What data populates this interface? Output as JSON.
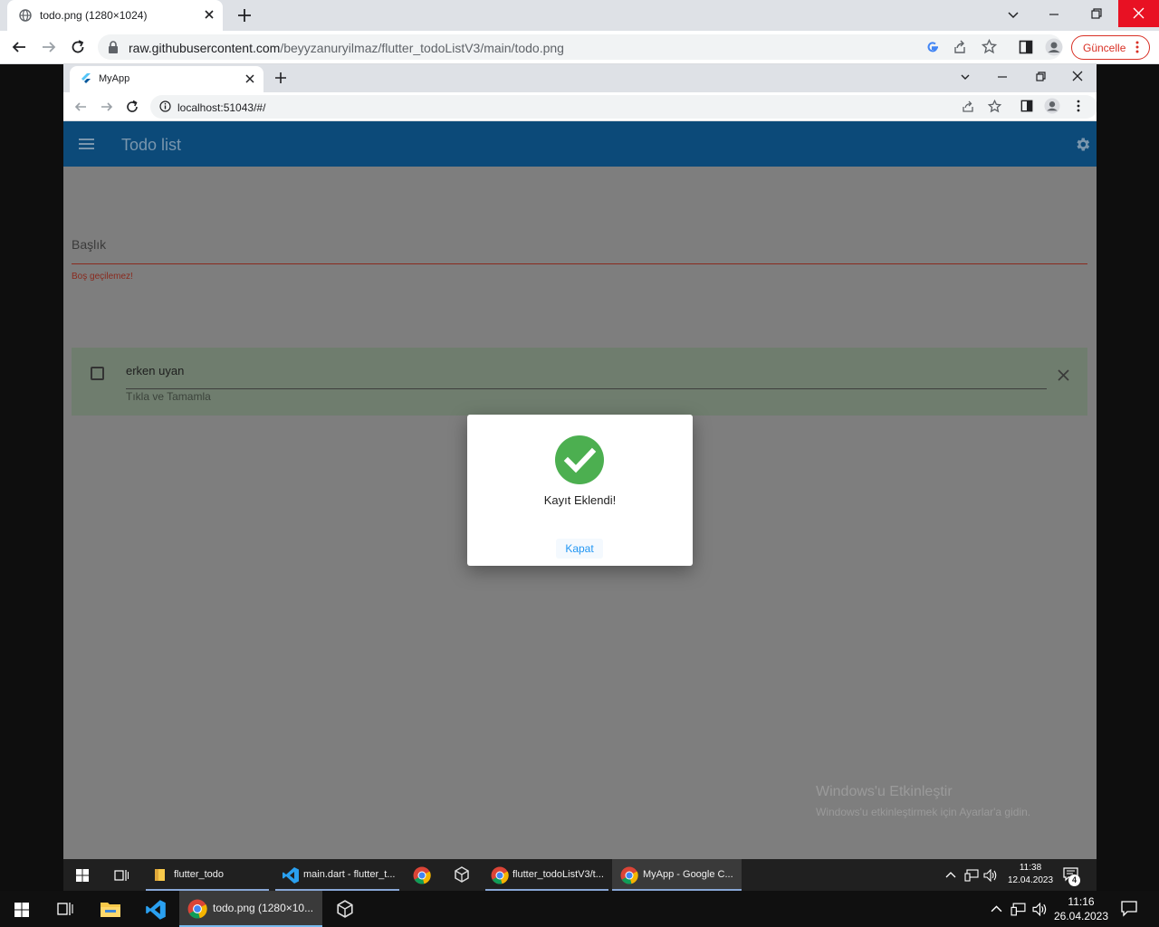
{
  "outer_browser": {
    "tab_title": "todo.png (1280×1024)",
    "url_host": "raw.githubusercontent.com",
    "url_path": "/beyyzanuryilmaz/flutter_todoListV3/main/todo.png",
    "update_label": "Güncelle"
  },
  "inner_browser": {
    "tab_title": "MyApp",
    "url": "localhost:51043/#/"
  },
  "app": {
    "title": "Todo list",
    "field_label": "Başlık",
    "field_error": "Boş geçilemez!",
    "todos": [
      {
        "title": "erken uyan",
        "subtitle": "Tıkla ve Tamamla",
        "checked": false
      }
    ]
  },
  "dialog": {
    "message": "Kayıt Eklendi!",
    "button": "Kapat"
  },
  "watermark": {
    "title": "Windows'u Etkinleştir",
    "subtitle": "Windows'u etkinleştirmek için Ayarlar'a gidin."
  },
  "inner_taskbar": {
    "items": [
      "flutter_todo",
      "main.dart - flutter_t...",
      "flutter_todoListV3/t...",
      "MyApp - Google C..."
    ],
    "time": "11:38",
    "date": "12.04.2023",
    "notifications": "4"
  },
  "outer_taskbar": {
    "items": [
      "todo.png (1280×10..."
    ],
    "time": "11:16",
    "date": "26.04.2023"
  },
  "colors": {
    "appbar": "#0c4a79",
    "success": "#4caf50",
    "link": "#2196f3",
    "error": "#8a2a1e"
  }
}
